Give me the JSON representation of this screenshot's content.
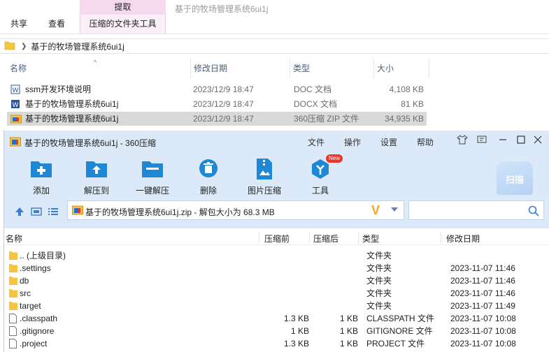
{
  "explorer": {
    "ribbon": {
      "tabs": [
        "共享",
        "查看"
      ],
      "context_header": "提取",
      "context_tab": "压缩的文件夹工具",
      "window_title": "基于的牧场管理系统6ui1j"
    },
    "address": {
      "path": "基于的牧场管理系统6ui1j"
    },
    "columns": {
      "name": "名称",
      "date": "修改日期",
      "type": "类型",
      "size": "大小"
    },
    "files": [
      {
        "name": "ssm开发环境说明",
        "date": "2023/12/9 18:47",
        "type": "DOC 文档",
        "size": "4,108 KB",
        "icon": "word-doc-icon",
        "selected": false
      },
      {
        "name": "基于的牧场管理系统6ui1j",
        "date": "2023/12/9 18:47",
        "type": "DOCX 文档",
        "size": "81 KB",
        "icon": "word-docx-icon",
        "selected": false
      },
      {
        "name": "基于的牧场管理系统6ui1j",
        "date": "2023/12/9 18:47",
        "type": "360压缩 ZIP 文件",
        "size": "34,935 KB",
        "icon": "zip-archive-icon",
        "selected": true
      }
    ]
  },
  "zip_window": {
    "title": "基于的牧场管理系统6ui1j - 360压缩",
    "menu": [
      "文件",
      "操作",
      "设置",
      "帮助"
    ],
    "tools": [
      {
        "label": "添加",
        "icon": "add-icon"
      },
      {
        "label": "解压到",
        "icon": "extract-to-icon"
      },
      {
        "label": "一键解压",
        "icon": "one-click-extract-icon"
      },
      {
        "label": "删除",
        "icon": "delete-icon"
      },
      {
        "label": "图片压缩",
        "icon": "image-compress-icon"
      },
      {
        "label": "工具",
        "icon": "tools-icon",
        "badge": "New"
      }
    ],
    "scan_label": "扫描",
    "path_text": "基于的牧场管理系统6ui1j.zip - 解包大小为 68.3 MB",
    "columns": {
      "name": "名称",
      "compressed": "压缩前",
      "uncompressed": "压缩后",
      "type": "类型",
      "modified": "修改日期"
    },
    "entries": [
      {
        "name": ".. (上级目录)",
        "before": "",
        "after": "",
        "type": "文件夹",
        "modified": "",
        "kind": "folder"
      },
      {
        "name": ".settings",
        "before": "",
        "after": "",
        "type": "文件夹",
        "modified": "2023-11-07 11:46",
        "kind": "folder"
      },
      {
        "name": "db",
        "before": "",
        "after": "",
        "type": "文件夹",
        "modified": "2023-11-07 11:46",
        "kind": "folder"
      },
      {
        "name": "src",
        "before": "",
        "after": "",
        "type": "文件夹",
        "modified": "2023-11-07 11:46",
        "kind": "folder"
      },
      {
        "name": "target",
        "before": "",
        "after": "",
        "type": "文件夹",
        "modified": "2023-11-07 11:49",
        "kind": "folder"
      },
      {
        "name": ".classpath",
        "before": "1.3 KB",
        "after": "1 KB",
        "type": "CLASSPATH 文件",
        "modified": "2023-11-07 10:08",
        "kind": "file"
      },
      {
        "name": ".gitignore",
        "before": "1 KB",
        "after": "1 KB",
        "type": "GITIGNORE 文件",
        "modified": "2023-11-07 10:08",
        "kind": "file"
      },
      {
        "name": ".project",
        "before": "1.3 KB",
        "after": "1 KB",
        "type": "PROJECT 文件",
        "modified": "2023-11-07 10:08",
        "kind": "file"
      }
    ]
  },
  "colors": {
    "accent_blue": "#1e88d6",
    "zip_bg": "#dbe9f8",
    "context_pink": "#f6d9ee",
    "folder_yellow": "#f5c542"
  }
}
